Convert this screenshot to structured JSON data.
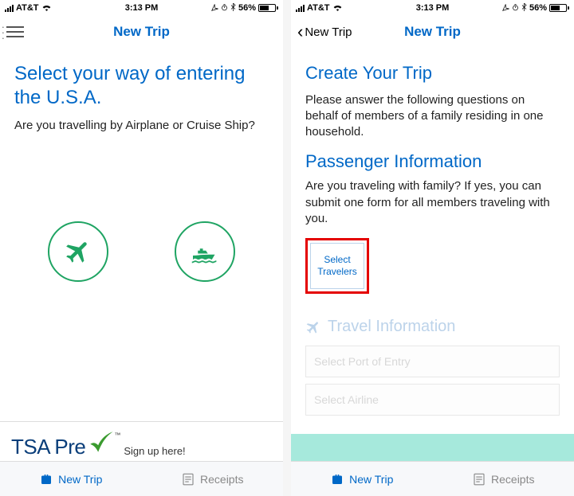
{
  "status": {
    "carrier": "AT&T",
    "time": "3:13 PM",
    "battery_pct": "56%",
    "icons_right": "↗ ⏰ ∗"
  },
  "left": {
    "nav_title": "New Trip",
    "heading": "Select your way of entering the U.S.A.",
    "subtext": "Are you travelling by Airplane or Cruise Ship?",
    "options": {
      "plane": "airplane",
      "ship": "cruise-ship"
    },
    "tsa": {
      "brand_prefix": "TSA Pre",
      "link": "Sign up here!"
    }
  },
  "right": {
    "nav_back": "New Trip",
    "nav_title": "New Trip",
    "h1": "Create Your Trip",
    "p1": "Please answer the following questions on behalf of members of a family residing in one household.",
    "h2": "Passenger Information",
    "p2": "Are you traveling with family? If yes, you can submit one form for all members traveling with you.",
    "select_travelers": "Select Travelers",
    "travel_info_title": "Travel Information",
    "port_placeholder": "Select Port of Entry",
    "airline_placeholder": "Select Airline"
  },
  "tabs": {
    "new_trip": "New Trip",
    "receipts": "Receipts"
  }
}
